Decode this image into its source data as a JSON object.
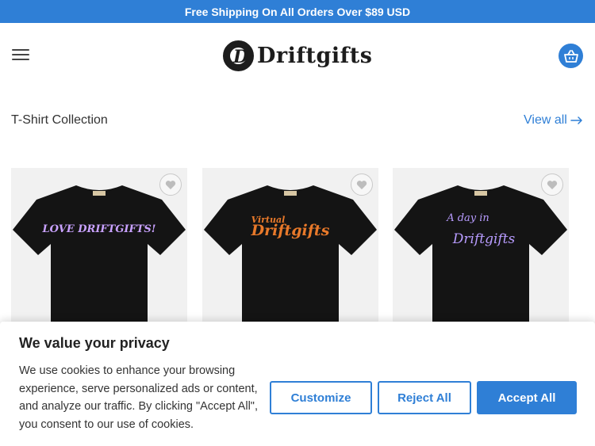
{
  "topbar": {
    "text": "Free Shipping On All Orders Over $89 USD"
  },
  "header": {
    "logo_letter": "D",
    "logo_text": "Driftgifts"
  },
  "collection": {
    "title": "T-Shirt Collection",
    "view_all": "View all"
  },
  "products": [
    {
      "print_text": "LOVE DRIFTGIFTS!",
      "print_color": "#c9a2ff"
    },
    {
      "print_line1": "Virtual",
      "print_line2": "Driftgifts",
      "print_color": "#e8792a"
    },
    {
      "print_line1": "A day in",
      "print_line2": "Driftgifts",
      "print_color": "#b89cff"
    }
  ],
  "cookie": {
    "title": "We value your privacy",
    "body": "We use cookies to enhance your browsing experience, serve personalized ads or content, and analyze our traffic. By clicking \"Accept All\", you consent to our use of cookies.",
    "customize": "Customize",
    "reject": "Reject All",
    "accept": "Accept All"
  },
  "colors": {
    "accent": "#2f7fd6",
    "shirt": "#141414"
  }
}
